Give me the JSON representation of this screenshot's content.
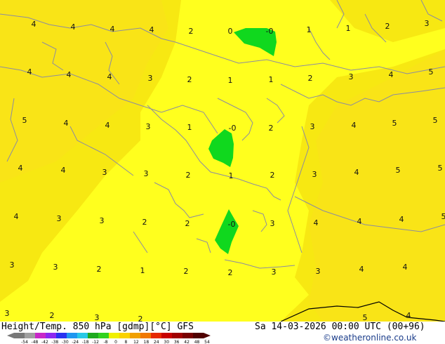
{
  "map": {
    "colors": {
      "band_2_4": "#f7e812",
      "band_0_2": "#ffff1e",
      "band_4_6": "#f9e417",
      "band_neg2_0": "#10d81e",
      "band_neg": "#32e41e",
      "coast": "#8c8ca0",
      "contour": "#000000"
    },
    "contour_labels": [
      {
        "t": "4"
      },
      {
        "t": "4"
      },
      {
        "t": "4"
      },
      {
        "t": "4"
      },
      {
        "t": "2"
      },
      {
        "t": "0"
      },
      {
        "t": "-0"
      },
      {
        "t": "1"
      },
      {
        "t": "1"
      },
      {
        "t": "2"
      },
      {
        "t": "3"
      },
      {
        "t": "4"
      },
      {
        "t": "4"
      },
      {
        "t": "4"
      },
      {
        "t": "3"
      },
      {
        "t": "2"
      },
      {
        "t": "1"
      },
      {
        "t": "1"
      },
      {
        "t": "2"
      },
      {
        "t": "3"
      },
      {
        "t": "4"
      },
      {
        "t": "5"
      },
      {
        "t": "5"
      },
      {
        "t": "4"
      },
      {
        "t": "4"
      },
      {
        "t": "3"
      },
      {
        "t": "1"
      },
      {
        "t": "-0"
      },
      {
        "t": "2"
      },
      {
        "t": "3"
      },
      {
        "t": "4"
      },
      {
        "t": "5"
      },
      {
        "t": "5"
      },
      {
        "t": "4"
      },
      {
        "t": "4"
      },
      {
        "t": "3"
      },
      {
        "t": "3"
      },
      {
        "t": "2"
      },
      {
        "t": "1"
      },
      {
        "t": "2"
      },
      {
        "t": "3"
      },
      {
        "t": "4"
      },
      {
        "t": "5"
      },
      {
        "t": "5"
      },
      {
        "t": "4"
      },
      {
        "t": "3"
      },
      {
        "t": "3"
      },
      {
        "t": "2"
      },
      {
        "t": "2"
      },
      {
        "t": "-0"
      },
      {
        "t": "3"
      },
      {
        "t": "4"
      },
      {
        "t": "4"
      },
      {
        "t": "4"
      },
      {
        "t": "5"
      },
      {
        "t": "3"
      },
      {
        "t": "3"
      },
      {
        "t": "2"
      },
      {
        "t": "1"
      },
      {
        "t": "2"
      },
      {
        "t": "2"
      },
      {
        "t": "3"
      },
      {
        "t": "3"
      },
      {
        "t": "4"
      },
      {
        "t": "4"
      },
      {
        "t": "3"
      },
      {
        "t": "2"
      },
      {
        "t": "3"
      },
      {
        "t": "2"
      },
      {
        "t": "4"
      },
      {
        "t": "5"
      }
    ]
  },
  "footer": {
    "title": "Height/Temp. 850 hPa [gdmp][°C] GFS",
    "datetime": "Sa 14-03-2026 00:00 UTC (00+96)",
    "credit": "©weatheronline.co.uk",
    "legend_ticks": [
      "-54",
      "-48",
      "-42",
      "-38",
      "-30",
      "-24",
      "-18",
      "-12",
      "-8",
      "0",
      "8",
      "12",
      "18",
      "24",
      "30",
      "36",
      "42",
      "48",
      "54"
    ],
    "legend_colors": [
      "#787878",
      "#a0a0a0",
      "#c828c8",
      "#8c28f0",
      "#2832f0",
      "#1e96f0",
      "#28c8e6",
      "#1eaa1e",
      "#32d21e",
      "#f0f000",
      "#fad200",
      "#f0a000",
      "#f07800",
      "#e62800",
      "#c80000",
      "#a00000",
      "#780000",
      "#500000"
    ]
  }
}
